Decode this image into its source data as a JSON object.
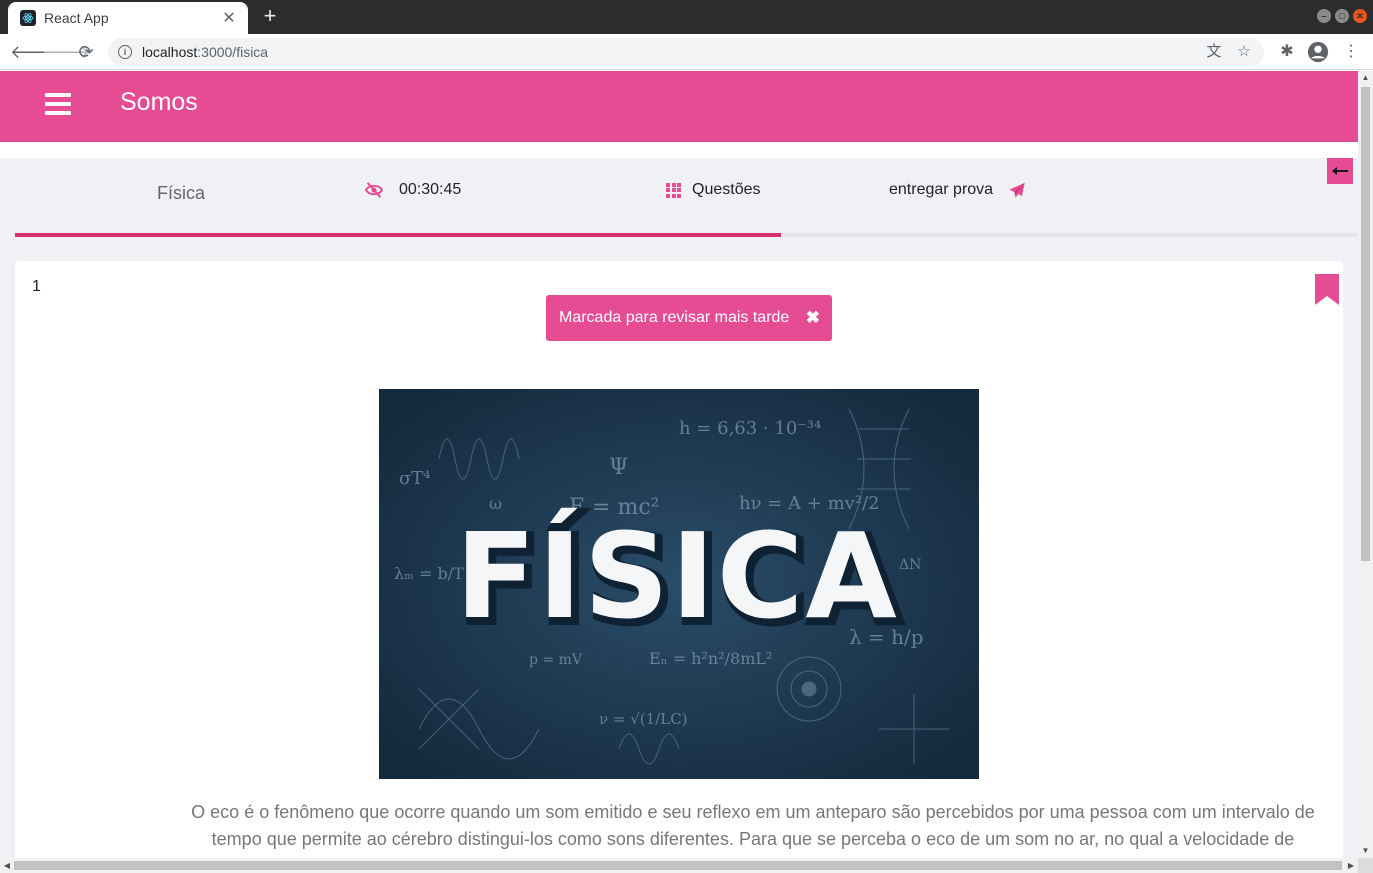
{
  "browser": {
    "tab_title": "React App",
    "url_host": "localhost",
    "url_path": ":3000/fisica"
  },
  "app": {
    "title": "Somos"
  },
  "exam": {
    "subject": "Física",
    "timer": "00:30:45",
    "questions_label": "Questões",
    "submit_label": "entregar prova",
    "progress": 0.57
  },
  "question": {
    "number": "1",
    "toast_message": "Marcada para revisar mais tarde",
    "toast_close": "✖",
    "image_title": "FÍSICA",
    "image_formulas": [
      "E = mc²",
      "h = 6,63 · 10⁻³⁴",
      "λ = h/p",
      "hν = A + mv²/2",
      "Ψ",
      "σT⁴",
      "Eₙ = h²n²/8mL²",
      "ΔN",
      "ω",
      "λₘ = b/T",
      "ν = √(1/LC)",
      "p = mV"
    ],
    "text": "O eco é o fenômeno que ocorre quando um som emitido e seu reflexo em um anteparo são percebidos por uma pessoa com um intervalo de tempo que permite ao cérebro distingui-los como sons diferentes. Para que se perceba o eco de um som no ar, no qual a velocidade de"
  },
  "colors": {
    "primary": "#e54c94",
    "progress": "#d5306a",
    "background": "#f0f1f5"
  }
}
